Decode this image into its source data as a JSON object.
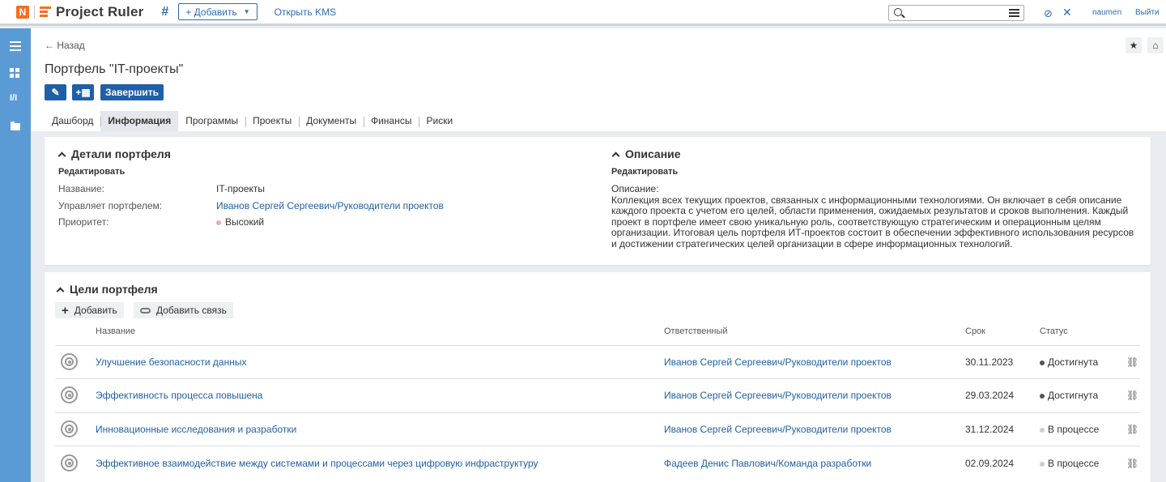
{
  "header": {
    "brand": "Project Ruler",
    "add_label": "+ Добавить",
    "kms_label": "Открыть KMS",
    "search_placeholder": "",
    "user": "naumen",
    "logout": "Выйти"
  },
  "nav": {
    "back": "← Назад",
    "title": "Портфель \"IT-проекты\"",
    "finish_label": "Завершить",
    "tabs": [
      {
        "label": "Дашборд"
      },
      {
        "label": "Информация",
        "active": true
      },
      {
        "label": "Программы"
      },
      {
        "label": "Проекты"
      },
      {
        "label": "Документы"
      },
      {
        "label": "Финансы"
      },
      {
        "label": "Риски"
      }
    ]
  },
  "details": {
    "title": "Детали портфеля",
    "edit": "Редактировать",
    "name_label": "Название:",
    "name_value": "IT-проекты",
    "manager_label": "Управляет портфелем:",
    "manager_value": "Иванов Сергей Сергеевич/Руководители проектов",
    "priority_label": "Приоритет:",
    "priority_value": "Высокий",
    "priority_color": "#f4a9a8"
  },
  "description": {
    "title": "Описание",
    "edit": "Редактировать",
    "label": "Описание:",
    "lines": [
      "Коллекция всех текущих проектов, связанных с информационными технологиями. Он включает в себя описание",
      "каждого проекта с учетом его целей, области применения, ожидаемых результатов и сроков выполнения. Каждый",
      "проект в портфеле имеет свою уникальную роль, соответствующую стратегическим и операционным целям",
      "организации. Итоговая цель портфеля ИТ-проектов состоит в обеспечении эффективного использования ресурсов",
      "и достижении стратегических целей организации в сфере информационных технологий."
    ]
  },
  "goals": {
    "title": "Цели портфеля",
    "add_label": "Добавить",
    "add_link_label": "Добавить связь",
    "columns": {
      "name": "Название",
      "owner": "Ответственный",
      "deadline": "Срок",
      "status": "Статус"
    },
    "rows": [
      {
        "name": "Улучшение безопасности данных",
        "owner": "Иванов Сергей Сергеевич/Руководители проектов",
        "deadline": "30.11.2023",
        "status": "Достигнута",
        "status_color": "#555555"
      },
      {
        "name": "Эффективность процесса повышена",
        "owner": "Иванов Сергей Сергеевич/Руководители проектов",
        "deadline": "29.03.2024",
        "status": "Достигнута",
        "status_color": "#555555"
      },
      {
        "name": "Инновационные исследования и разработки",
        "owner": "Иванов Сергей Сергеевич/Руководители проектов",
        "deadline": "31.12.2024",
        "status": "В процессе",
        "status_color": "#cccccc"
      },
      {
        "name": "Эффективное взаимодействие между системами и процессами через цифровую инфраструктуру",
        "owner": "Фадеев Денис Павлович/Команда разработки",
        "deadline": "02.09.2024",
        "status": "В процессе",
        "status_color": "#cccccc"
      }
    ]
  },
  "colors": {
    "accent": "#1f5fa6",
    "sidebar": "#5b9bd5",
    "brand": "#f37021"
  }
}
